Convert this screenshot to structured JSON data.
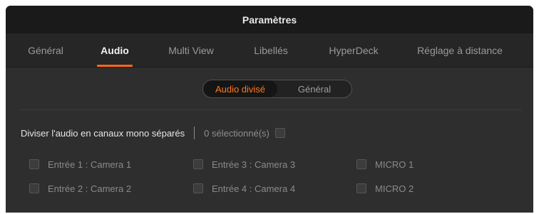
{
  "window": {
    "title": "Paramètres"
  },
  "tabs": [
    {
      "label": "Général",
      "active": false
    },
    {
      "label": "Audio",
      "active": true
    },
    {
      "label": "Multi View",
      "active": false
    },
    {
      "label": "Libellés",
      "active": false
    },
    {
      "label": "HyperDeck",
      "active": false
    },
    {
      "label": "Réglage à distance",
      "active": false
    }
  ],
  "segmented": {
    "options": [
      {
        "label": "Audio divisé",
        "active": true
      },
      {
        "label": "Général",
        "active": false
      }
    ]
  },
  "split_audio": {
    "label": "Diviser l'audio en canaux mono séparés",
    "selected_count_text": "0 sélectionné(s)"
  },
  "inputs": [
    {
      "label": "Entrée 1 : Camera 1",
      "checked": false
    },
    {
      "label": "Entrée 2 : Camera 2",
      "checked": false
    },
    {
      "label": "Entrée 3 : Camera 3",
      "checked": false
    },
    {
      "label": "Entrée 4 : Camera 4",
      "checked": false
    },
    {
      "label": "MICRO 1",
      "checked": false
    },
    {
      "label": "MICRO 2",
      "checked": false
    }
  ],
  "colors": {
    "accent": "#ff6a1a",
    "panel_background": "#2e2e2e",
    "titlebar_background": "#1a1a1a"
  }
}
